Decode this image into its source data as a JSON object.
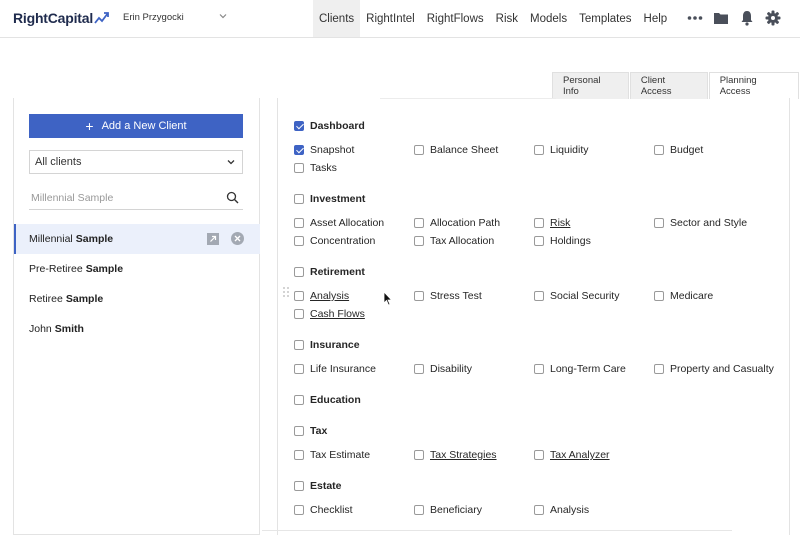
{
  "brand": {
    "name": "RightCapital"
  },
  "user": {
    "name": "Erin Przygocki"
  },
  "nav": {
    "items": [
      "Clients",
      "RightIntel",
      "RightFlows",
      "Risk",
      "Models",
      "Templates",
      "Help"
    ],
    "active": "Clients",
    "icons": [
      "more-icon",
      "folder-icon",
      "bell-icon",
      "gear-icon"
    ]
  },
  "tabs": {
    "items": [
      "Personal Info",
      "Client Access",
      "Planning Access"
    ],
    "active": "Planning Access"
  },
  "clients_panel": {
    "add_button": "Add a New Client",
    "filter": "All clients",
    "search_placeholder": "Millennial Sample",
    "clients": [
      {
        "first": "Millennial",
        "last": "Sample",
        "selected": true
      },
      {
        "first": "Pre-Retiree",
        "last": "Sample",
        "selected": false
      },
      {
        "first": "Retiree",
        "last": "Sample",
        "selected": false
      },
      {
        "first": "John",
        "last": "Smith",
        "selected": false
      }
    ]
  },
  "permissions": {
    "sections": [
      {
        "title": "Dashboard",
        "checked": true,
        "items": [
          {
            "label": "Snapshot",
            "checked": true,
            "link": false
          },
          {
            "label": "Balance Sheet",
            "checked": false,
            "link": false
          },
          {
            "label": "Liquidity",
            "checked": false,
            "link": false
          },
          {
            "label": "Budget",
            "checked": false,
            "link": false
          },
          {
            "label": "Tasks",
            "checked": false,
            "link": false
          }
        ]
      },
      {
        "title": "Investment",
        "checked": false,
        "items": [
          {
            "label": "Asset Allocation",
            "checked": false,
            "link": false
          },
          {
            "label": "Allocation Path",
            "checked": false,
            "link": false
          },
          {
            "label": "Risk",
            "checked": false,
            "link": true
          },
          {
            "label": "Sector and Style",
            "checked": false,
            "link": false
          },
          {
            "label": "Concentration",
            "checked": false,
            "link": false
          },
          {
            "label": "Tax Allocation",
            "checked": false,
            "link": false
          },
          {
            "label": "Holdings",
            "checked": false,
            "link": false
          }
        ]
      },
      {
        "title": "Retirement",
        "checked": false,
        "items": [
          {
            "label": "Analysis",
            "checked": false,
            "link": true
          },
          {
            "label": "Stress Test",
            "checked": false,
            "link": false
          },
          {
            "label": "Social Security",
            "checked": false,
            "link": false
          },
          {
            "label": "Medicare",
            "checked": false,
            "link": false
          },
          {
            "label": "Cash Flows",
            "checked": false,
            "link": true
          }
        ]
      },
      {
        "title": "Insurance",
        "checked": false,
        "items": [
          {
            "label": "Life Insurance",
            "checked": false,
            "link": false
          },
          {
            "label": "Disability",
            "checked": false,
            "link": false
          },
          {
            "label": "Long-Term Care",
            "checked": false,
            "link": false
          },
          {
            "label": "Property and Casualty",
            "checked": false,
            "link": false
          }
        ]
      },
      {
        "title": "Education",
        "checked": false,
        "items": []
      },
      {
        "title": "Tax",
        "checked": false,
        "items": [
          {
            "label": "Tax Estimate",
            "checked": false,
            "link": false
          },
          {
            "label": "Tax Strategies",
            "checked": false,
            "link": true
          },
          {
            "label": "Tax Analyzer",
            "checked": false,
            "link": true
          }
        ]
      },
      {
        "title": "Estate",
        "checked": false,
        "items": [
          {
            "label": "Checklist",
            "checked": false,
            "link": false
          },
          {
            "label": "Beneficiary",
            "checked": false,
            "link": false
          },
          {
            "label": "Analysis",
            "checked": false,
            "link": false
          }
        ]
      }
    ]
  },
  "colors": {
    "accent": "#3e63c4",
    "active_nav_bg": "#efefef",
    "selected_row_bg": "#ebf0fb"
  }
}
